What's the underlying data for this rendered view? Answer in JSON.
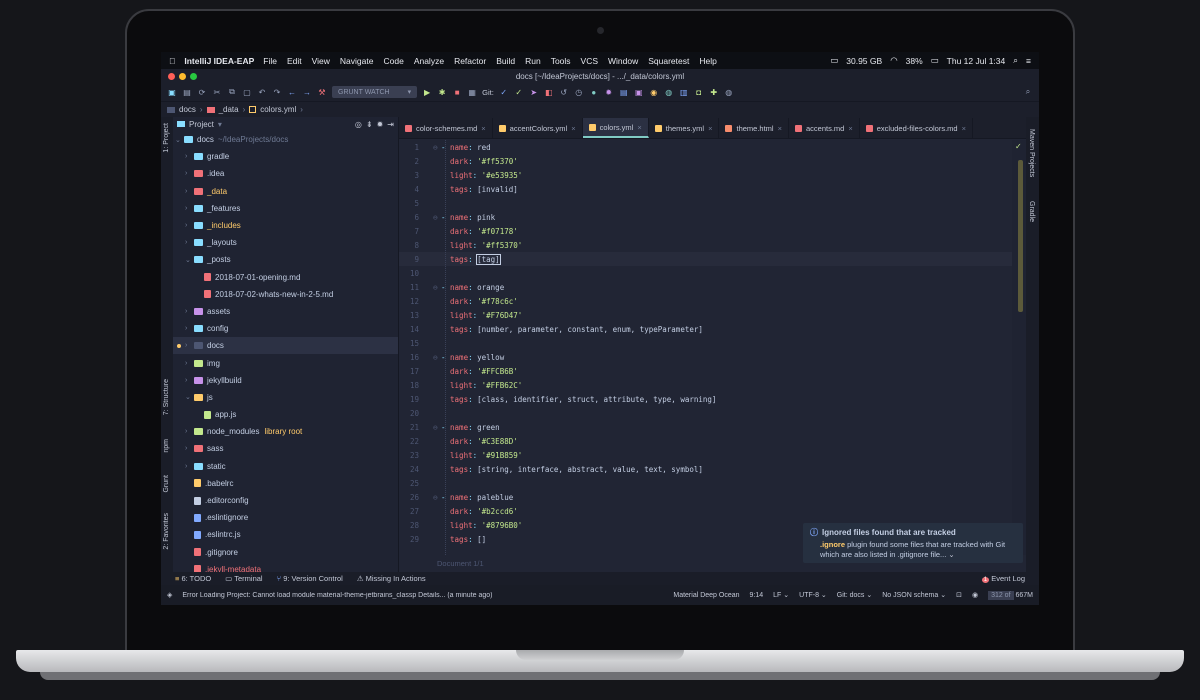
{
  "menubar": {
    "apple_icon": "apple-icon",
    "app_name": "IntelliJ IDEA-EAP",
    "items": [
      "File",
      "Edit",
      "View",
      "Navigate",
      "Code",
      "Analyze",
      "Refactor",
      "Build",
      "Run",
      "Tools",
      "VCS",
      "Window",
      "Squaretest",
      "Help"
    ],
    "disk": "30.95 GB",
    "battery": "38%",
    "clock": "Thu 12 Jul  1:34"
  },
  "window": {
    "title": "docs [~/IdeaProjects/docs] - .../_data/colors.yml",
    "traffic_colors": [
      "#ff5f57",
      "#febc2e",
      "#28c840"
    ]
  },
  "toolbar": {
    "run_config": "GRUNT WATCH",
    "git_label": "Git:"
  },
  "navbar": {
    "crumbs": [
      "docs",
      "_data",
      "colors.yml"
    ]
  },
  "project_panel": {
    "title": "Project",
    "side_labels": [
      "1: Project",
      "7: Structure",
      "npm",
      "Grunt",
      "2: Favorites"
    ],
    "root_name": "docs",
    "root_path": "~/IdeaProjects/docs",
    "items": [
      {
        "name": "gradle",
        "kind": "folder",
        "color": "#89ddff",
        "indent": 1,
        "arrow": "›",
        "name_color": "#c3cee3"
      },
      {
        "name": ".idea",
        "kind": "folder",
        "color": "#f07178",
        "indent": 1,
        "arrow": "›",
        "name_color": "#c3cee3"
      },
      {
        "name": "_data",
        "kind": "folder",
        "color": "#f07178",
        "indent": 1,
        "arrow": "›",
        "name_color": "#ffcb6b"
      },
      {
        "name": "_features",
        "kind": "folder",
        "color": "#89ddff",
        "indent": 1,
        "arrow": "›",
        "name_color": "#c3cee3"
      },
      {
        "name": "_includes",
        "kind": "folder",
        "color": "#89ddff",
        "indent": 1,
        "arrow": "›",
        "name_color": "#ffcb6b"
      },
      {
        "name": "_layouts",
        "kind": "folder",
        "color": "#89ddff",
        "indent": 1,
        "arrow": "›",
        "name_color": "#c3cee3"
      },
      {
        "name": "_posts",
        "kind": "folder",
        "color": "#89ddff",
        "indent": 1,
        "arrow": "⌄",
        "name_color": "#c3cee3"
      },
      {
        "name": "2018-07-01-opening.md",
        "kind": "file",
        "color": "#f07178",
        "indent": 2,
        "arrow": "",
        "name_color": "#c3cee3"
      },
      {
        "name": "2018-07-02-whats-new-in-2-5.md",
        "kind": "file",
        "color": "#f07178",
        "indent": 2,
        "arrow": "",
        "name_color": "#c3cee3"
      },
      {
        "name": "assets",
        "kind": "folder",
        "color": "#c792ea",
        "indent": 1,
        "arrow": "›",
        "name_color": "#c3cee3"
      },
      {
        "name": "config",
        "kind": "folder",
        "color": "#89ddff",
        "indent": 1,
        "arrow": "›",
        "name_color": "#c3cee3"
      },
      {
        "name": "docs",
        "kind": "folder",
        "color": "#4d5672",
        "indent": 1,
        "arrow": "›",
        "name_color": "#c3cee3"
      },
      {
        "name": "img",
        "kind": "folder",
        "color": "#c3e88d",
        "indent": 1,
        "arrow": "›",
        "name_color": "#c3cee3"
      },
      {
        "name": "jekyllbuild",
        "kind": "folder",
        "color": "#c792ea",
        "indent": 1,
        "arrow": "›",
        "name_color": "#c3cee3"
      },
      {
        "name": "js",
        "kind": "folder",
        "color": "#ffcb6b",
        "indent": 1,
        "arrow": "⌄",
        "name_color": "#c3cee3"
      },
      {
        "name": "app.js",
        "kind": "file",
        "color": "#c3e88d",
        "indent": 2,
        "arrow": "",
        "name_color": "#c3cee3"
      },
      {
        "name": "node_modules",
        "kind": "folder",
        "color": "#c3e88d",
        "indent": 1,
        "arrow": "›",
        "name_color": "#c3cee3",
        "extra": "library root"
      },
      {
        "name": "sass",
        "kind": "folder",
        "color": "#f07178",
        "indent": 1,
        "arrow": "›",
        "name_color": "#c3cee3"
      },
      {
        "name": "static",
        "kind": "folder",
        "color": "#89ddff",
        "indent": 1,
        "arrow": "›",
        "name_color": "#c3cee3"
      },
      {
        "name": ".babelrc",
        "kind": "file",
        "color": "#ffcb6b",
        "indent": 1,
        "arrow": "",
        "name_color": "#c3cee3"
      },
      {
        "name": ".editorconfig",
        "kind": "file",
        "color": "#c3cee3",
        "indent": 1,
        "arrow": "",
        "name_color": "#c3cee3"
      },
      {
        "name": ".eslintignore",
        "kind": "file",
        "color": "#82aaff",
        "indent": 1,
        "arrow": "",
        "name_color": "#c3cee3"
      },
      {
        "name": ".eslintrc.js",
        "kind": "file",
        "color": "#82aaff",
        "indent": 1,
        "arrow": "",
        "name_color": "#c3cee3"
      },
      {
        "name": ".gitignore",
        "kind": "file",
        "color": "#f07178",
        "indent": 1,
        "arrow": "",
        "name_color": "#c3cee3"
      },
      {
        "name": ".jekyll-metadata",
        "kind": "file",
        "color": "#f07178",
        "indent": 1,
        "arrow": "",
        "name_color": "#f07178"
      }
    ]
  },
  "tabs": [
    {
      "label": "color-schemes.md",
      "icon_color": "#f07178",
      "active": false
    },
    {
      "label": "accentColors.yml",
      "icon_color": "#ffcb6b",
      "active": false
    },
    {
      "label": "colors.yml",
      "icon_color": "#ffcb6b",
      "active": true
    },
    {
      "label": "themes.yml",
      "icon_color": "#ffcb6b",
      "active": false
    },
    {
      "label": "theme.html",
      "icon_color": "#f78c6c",
      "active": false
    },
    {
      "label": "accents.md",
      "icon_color": "#f07178",
      "active": false
    },
    {
      "label": "excluded-files-colors.md",
      "icon_color": "#f07178",
      "active": false
    }
  ],
  "code_lines": [
    {
      "n": "1",
      "type": "name",
      "val": "red"
    },
    {
      "n": "2",
      "type": "dark",
      "val": "'#ff5370'"
    },
    {
      "n": "3",
      "type": "light",
      "val": "'#e53935'"
    },
    {
      "n": "4",
      "type": "tags",
      "val": "[invalid]"
    },
    {
      "n": "5",
      "type": "blank",
      "val": ""
    },
    {
      "n": "6",
      "type": "name",
      "val": "pink"
    },
    {
      "n": "7",
      "type": "dark",
      "val": "'#f07178'"
    },
    {
      "n": "8",
      "type": "light",
      "val": "'#ff5370'"
    },
    {
      "n": "9",
      "type": "tags",
      "val": "[tag]",
      "current": true
    },
    {
      "n": "10",
      "type": "blank",
      "val": ""
    },
    {
      "n": "11",
      "type": "name",
      "val": "orange"
    },
    {
      "n": "12",
      "type": "dark",
      "val": "'#f78c6c'"
    },
    {
      "n": "13",
      "type": "light",
      "val": "'#F76D47'"
    },
    {
      "n": "14",
      "type": "tags",
      "val": "[number, parameter, constant, enum, typeParameter]"
    },
    {
      "n": "15",
      "type": "blank",
      "val": ""
    },
    {
      "n": "16",
      "type": "name",
      "val": "yellow"
    },
    {
      "n": "17",
      "type": "dark",
      "val": "'#FFCB6B'"
    },
    {
      "n": "18",
      "type": "light",
      "val": "'#FFB62C'"
    },
    {
      "n": "19",
      "type": "tags",
      "val": "[class, identifier, struct, attribute, type, warning]"
    },
    {
      "n": "20",
      "type": "blank",
      "val": ""
    },
    {
      "n": "21",
      "type": "name",
      "val": "green"
    },
    {
      "n": "22",
      "type": "dark",
      "val": "'#C3E88D'"
    },
    {
      "n": "23",
      "type": "light",
      "val": "'#91B859'"
    },
    {
      "n": "24",
      "type": "tags",
      "val": "[string, interface, abstract, value, text, symbol]"
    },
    {
      "n": "25",
      "type": "blank",
      "val": ""
    },
    {
      "n": "26",
      "type": "name",
      "val": "paleblue"
    },
    {
      "n": "27",
      "type": "dark",
      "val": "'#b2ccd6'"
    },
    {
      "n": "28",
      "type": "light",
      "val": "'#8796B0'"
    },
    {
      "n": "29",
      "type": "tags",
      "val": "[]"
    }
  ],
  "editor_breadcrumb": "Document 1/1",
  "right_side_labels": [
    "Maven Projects",
    "Gradle"
  ],
  "notification": {
    "title": "Ignored files found that are tracked",
    "highlight": ".ignore",
    "body": " plugin found some files that are tracked with Git which are also listed in .gitignore file..."
  },
  "tool_windows": [
    "6: TODO",
    "Terminal",
    "9: Version Control",
    "Missing In Actions"
  ],
  "event_log": {
    "badge": "1",
    "label": "Event Log"
  },
  "status": {
    "message": "Error Loading Project: Cannot load module material-theme-jetbrains_classp Details... (a minute ago)",
    "theme": "Material Deep Ocean",
    "position": "9:14",
    "line_sep": "LF",
    "encoding": "UTF-8",
    "git": "Git: docs",
    "schema": "No JSON schema",
    "mem_used": "312 of",
    "mem_total": "667M"
  }
}
